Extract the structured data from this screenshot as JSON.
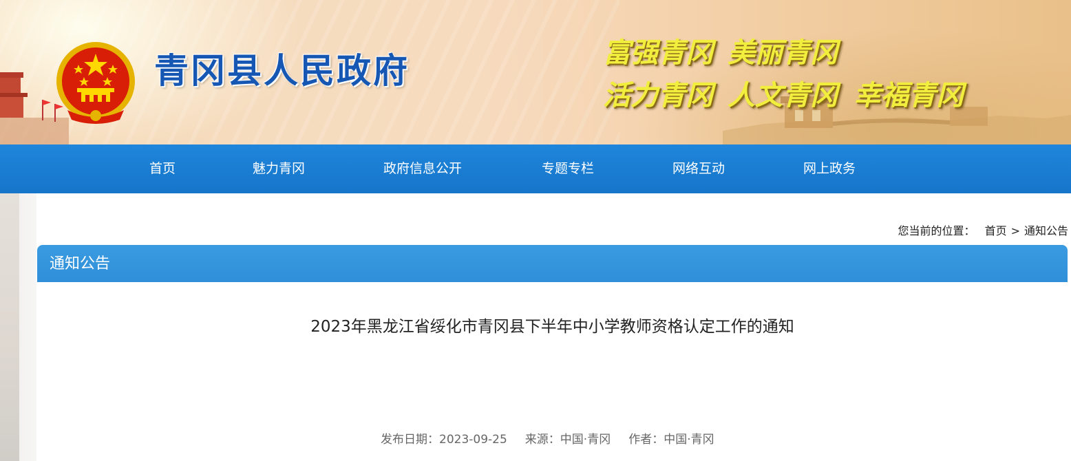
{
  "header": {
    "site_title": "青冈县人民政府",
    "slogans": [
      "富强青冈",
      "美丽青冈",
      "活力青冈",
      "人文青冈",
      "幸福青冈"
    ]
  },
  "nav": {
    "items": [
      "首页",
      "魅力青冈",
      "政府信息公开",
      "专题专栏",
      "网络互动",
      "网上政务"
    ]
  },
  "breadcrumb": {
    "label": "您当前的位置：",
    "home": "首页",
    "separator": ">",
    "current": "通知公告"
  },
  "section": {
    "title": "通知公告"
  },
  "article": {
    "title": "2023年黑龙江省绥化市青冈县下半年中小学教师资格认定工作的通知",
    "date_label": "发布日期：",
    "date": "2023-09-25",
    "source_label": "来源：",
    "source": "中国·青冈",
    "author_label": "作者：",
    "author": "中国·青冈"
  },
  "colors": {
    "nav_bg": "#1a7fd5",
    "section_bar": "#3394dc",
    "title_blue": "#1657b3",
    "slogan_yellow": "#f1ee3e"
  }
}
